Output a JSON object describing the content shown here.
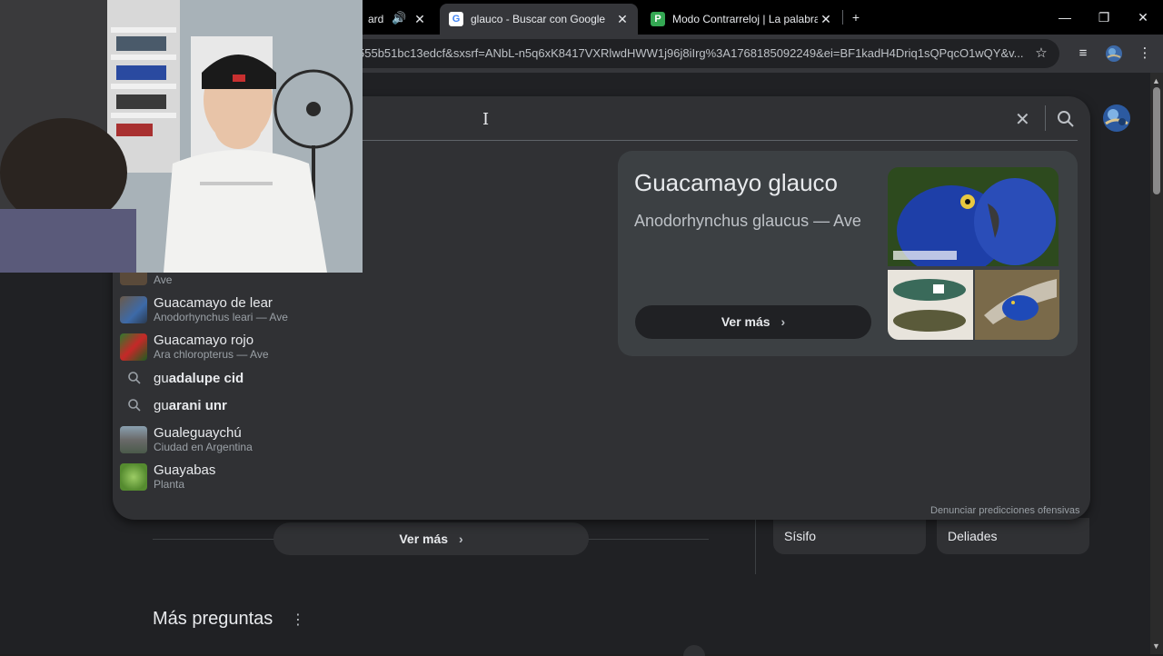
{
  "tabs": [
    {
      "title": "ard",
      "active": false
    },
    {
      "title": "glauco - Buscar con Google",
      "active": true
    },
    {
      "title": "Modo Contrarreloj | La palabra",
      "active": false
    }
  ],
  "toolbar": {
    "url": "555b51bc13edcf&sxsrf=ANbL-n5q6xK8417VXRlwdHWW1j96j8iIrg%3A1768185092249&ei=BF1kadH4Driq1sQPqcO1wQY&v..."
  },
  "suggestions": [
    {
      "kind": "entity",
      "title": "Guacamayo de lear",
      "subtitle": "Anodorhynchus leari — Ave"
    },
    {
      "kind": "entity",
      "title": "Guacamayo rojo",
      "subtitle": "Ara chloropterus — Ave"
    },
    {
      "kind": "query",
      "prefix": "gu",
      "rest": "adalupe cid"
    },
    {
      "kind": "query",
      "prefix": "gu",
      "rest": "arani unr"
    },
    {
      "kind": "entity",
      "title": "Gualeguaychú",
      "subtitle": "Ciudad en Argentina"
    },
    {
      "kind": "entity",
      "title": "Guayabas",
      "subtitle": "Planta"
    }
  ],
  "partial_suggestion_subtitle": "Ave",
  "knowledge_panel": {
    "title": "Guacamayo glauco",
    "subtitle": "Anodorhynchus glaucus — Ave",
    "more_label": "Ver más"
  },
  "report_link": "Denunciar predicciones ofensivas",
  "page": {
    "ver_mas": "Ver más",
    "more_questions": "Más preguntas",
    "chips": [
      "Sísifo",
      "Deliades"
    ]
  },
  "colors": {
    "bg": "#202124",
    "panel": "#303134",
    "accent_green": "#34a853"
  }
}
